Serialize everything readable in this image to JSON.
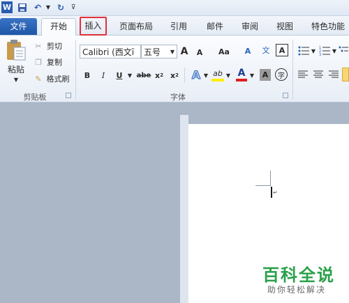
{
  "quick_access": {
    "app_icon": "word-icon",
    "save_icon": "save-icon",
    "undo_icon": "undo-icon",
    "redo_icon": "redo-icon",
    "customize_icon": "customize-qat-icon"
  },
  "tabs": [
    {
      "label": "文件"
    },
    {
      "label": "开始"
    },
    {
      "label": "插入"
    },
    {
      "label": "页面布局"
    },
    {
      "label": "引用"
    },
    {
      "label": "邮件"
    },
    {
      "label": "审阅"
    },
    {
      "label": "视图"
    },
    {
      "label": "特色功能"
    }
  ],
  "clipboard": {
    "paste_label": "粘贴",
    "cut_label": "剪切",
    "copy_label": "复制",
    "format_painter_label": "格式刷",
    "group_label": "剪贴板"
  },
  "font": {
    "font_name": "Calibri (西文ī",
    "font_size": "五号",
    "group_label": "字体",
    "grow_label": "A",
    "shrink_label": "A",
    "change_case_label": "Aa",
    "bold_label": "B",
    "italic_label": "I",
    "underline_label": "U",
    "strike_label": "abe",
    "subscript_label": "x",
    "superscript_label": "x",
    "text_effects_label": "A",
    "highlight_label": "ab",
    "font_color_label": "A",
    "char_shading_label": "A",
    "enclose_label": "字",
    "clear_label": "A",
    "phonetic_label": "文"
  },
  "watermark": {
    "title": "百科全说",
    "subtitle": "助你轻松解决"
  },
  "colors": {
    "file_tab": "#2a66b8",
    "highlight_box": "#e0303a",
    "doc_background": "#abb7c6",
    "watermark_green": "#2aa04a"
  }
}
